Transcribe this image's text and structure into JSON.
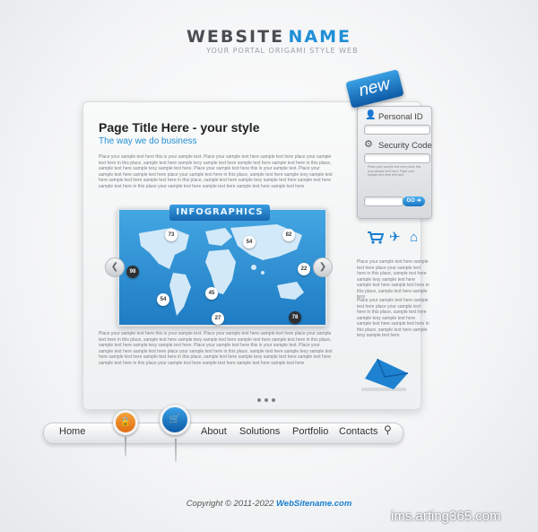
{
  "header": {
    "logo_part1": "Website",
    "logo_part2": "Name",
    "tagline": "Your portal origami style web"
  },
  "ribbon": {
    "label": "new"
  },
  "main": {
    "title": "Page Title Here - your style",
    "subtitle": "The way we do business",
    "para1": "Place your sample text here this is your sample text. Place your sample text here sample text here place your sample text here in this place, sample text here sample texy sample text here sample text here sample text here in this place, sample text here sample texy sample text here. Place your sample text here this is your sample text. Place your sample text here sample text here place your sample text here in this place, sample text here sample texy sample text here sample text here sample text here in this place, sample text here sample texy sample text here sample text here sample text here in this place your sample text here sample text here sample text here sample text here",
    "para2": "Place your sample text here this is your sample text. Place your sample text here sample text here place your sample text here in this place, sample text here sample texy sample text here sample text here sample text here in this place, sample text here sample texy sample text here. Place your sample text here this is your sample text. Place your sample text here sample text here place your sample text here in this place, sample text here sample texy sample text here sample text here sample text here in this place, sample text here sample texy sample text here sample text here sample text here in this place your sample text here sample text here sample text here sample text here"
  },
  "infographic": {
    "title": "Infographics",
    "bubbles": [
      "73",
      "54",
      "82",
      "98",
      "22",
      "54",
      "45",
      "27",
      "78"
    ],
    "prev_icon": "chevron-left-icon",
    "next_icon": "chevron-right-icon"
  },
  "login": {
    "personal_id_label": "Personal ID",
    "security_code_label": "Security Code",
    "note": "Place your sample text here place this your sample text here. Place your sample text here text here",
    "go_label": "GO ➜"
  },
  "side": {
    "icons": [
      "cart-icon",
      "plane-icon",
      "home-icon"
    ],
    "text1": "Place your sample text here sample text here place your sample text here in this place, sample text here sample texy sample text here sample text here sample text here in this place, sample text here sample texy",
    "text2": "Place your sample text here sample text here place your sample text here in this place, sample text here sample texy sample text here sample text here sample text here in this place, sample text here sample texy sample text here"
  },
  "nav": {
    "items": [
      "Home",
      "About",
      "Solutions",
      "Portfolio",
      "Contacts"
    ],
    "search_icon": "search-icon"
  },
  "footer": {
    "copyright": "Copyright © 2011-2022",
    "brand": "WebSitename.com"
  },
  "watermark": "ims.arting365.com",
  "colors": {
    "accent": "#1f8fd6",
    "dark_text": "#4a4d52",
    "orange_pin": "#f08a1c"
  }
}
